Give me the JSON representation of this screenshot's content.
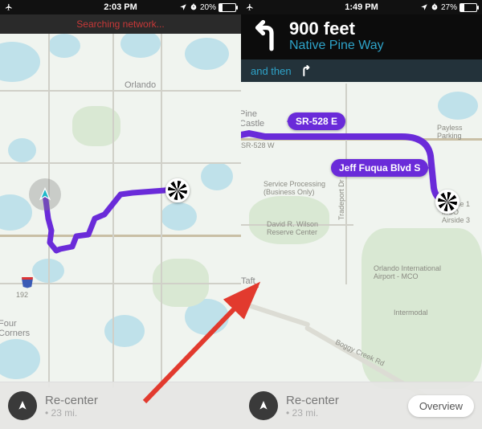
{
  "left": {
    "status": {
      "time": "2:03 PM",
      "battery_pct": "20%",
      "battery_fill": 20
    },
    "search_text": "Searching network...",
    "city": "Orlando",
    "corner_label": "Four\nCorners",
    "hwy_shield": "192",
    "recenter": {
      "label": "Re-center",
      "sub": "• 23 mi."
    }
  },
  "right": {
    "status": {
      "time": "1:49 PM",
      "battery_pct": "27%",
      "battery_fill": 27
    },
    "nav": {
      "distance": "900 feet",
      "street": "Native Pine Way",
      "and_then": "and then"
    },
    "pills": {
      "sr528": "SR-528 E",
      "jeff": "Jeff Fuqua Blvd S"
    },
    "labels": {
      "pine_castle": "Pine\nCastle",
      "sr528w": "SR-528 W",
      "payless": "Payless\nParking",
      "svc": "Service Processing\n(Business Only)",
      "wilson": "David R. Wilson\nReserve Center",
      "taft": "Taft",
      "tradeport": "Tradeport Dr",
      "airside": "Airside 1\nMCO\nAirside 3",
      "oia": "Orlando International\nAirport - MCO",
      "intermodal": "Intermodal",
      "boggy": "Boggy Creek Rd"
    },
    "recenter": {
      "label": "Re-center",
      "sub": "• 23 mi."
    },
    "overview": "Overview"
  }
}
